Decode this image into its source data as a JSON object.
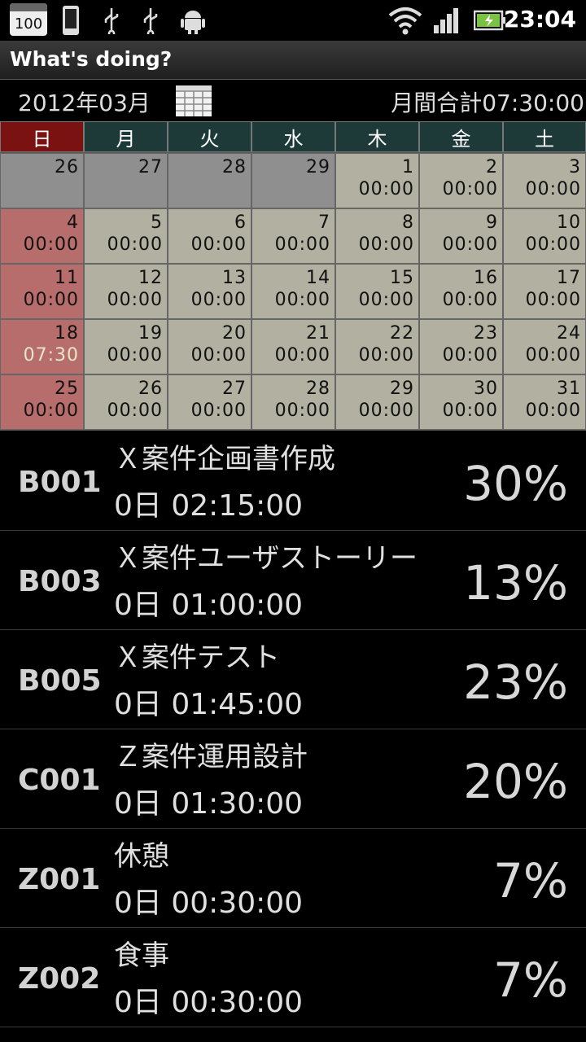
{
  "status_bar": {
    "calendar_badge": "100",
    "time": "23:04",
    "icons": [
      "calendar-icon",
      "phone-icon",
      "usb-icon",
      "usb-icon",
      "android-icon",
      "wifi-icon",
      "signal-icon",
      "battery-icon"
    ]
  },
  "app": {
    "title": "What's doing?"
  },
  "month_header": {
    "month": "2012年03月",
    "total": "月間合計07:30:00"
  },
  "calendar": {
    "weekdays": [
      "日",
      "月",
      "火",
      "水",
      "木",
      "金",
      "土"
    ],
    "weeks": [
      [
        {
          "day": "26",
          "time": "",
          "kind": "other"
        },
        {
          "day": "27",
          "time": "",
          "kind": "other"
        },
        {
          "day": "28",
          "time": "",
          "kind": "other"
        },
        {
          "day": "29",
          "time": "",
          "kind": "other"
        },
        {
          "day": "1",
          "time": "00:00",
          "kind": "normal"
        },
        {
          "day": "2",
          "time": "00:00",
          "kind": "normal"
        },
        {
          "day": "3",
          "time": "00:00",
          "kind": "normal"
        }
      ],
      [
        {
          "day": "4",
          "time": "00:00",
          "kind": "sunday"
        },
        {
          "day": "5",
          "time": "00:00",
          "kind": "normal"
        },
        {
          "day": "6",
          "time": "00:00",
          "kind": "normal"
        },
        {
          "day": "7",
          "time": "00:00",
          "kind": "normal"
        },
        {
          "day": "8",
          "time": "00:00",
          "kind": "normal"
        },
        {
          "day": "9",
          "time": "00:00",
          "kind": "normal"
        },
        {
          "day": "10",
          "time": "00:00",
          "kind": "normal"
        }
      ],
      [
        {
          "day": "11",
          "time": "00:00",
          "kind": "sunday"
        },
        {
          "day": "12",
          "time": "00:00",
          "kind": "normal"
        },
        {
          "day": "13",
          "time": "00:00",
          "kind": "normal"
        },
        {
          "day": "14",
          "time": "00:00",
          "kind": "normal"
        },
        {
          "day": "15",
          "time": "00:00",
          "kind": "normal"
        },
        {
          "day": "16",
          "time": "00:00",
          "kind": "normal"
        },
        {
          "day": "17",
          "time": "00:00",
          "kind": "normal"
        }
      ],
      [
        {
          "day": "18",
          "time": "07:30",
          "kind": "sunday",
          "highlight": true
        },
        {
          "day": "19",
          "time": "00:00",
          "kind": "normal"
        },
        {
          "day": "20",
          "time": "00:00",
          "kind": "normal"
        },
        {
          "day": "21",
          "time": "00:00",
          "kind": "normal"
        },
        {
          "day": "22",
          "time": "00:00",
          "kind": "normal"
        },
        {
          "day": "23",
          "time": "00:00",
          "kind": "normal"
        },
        {
          "day": "24",
          "time": "00:00",
          "kind": "normal"
        }
      ],
      [
        {
          "day": "25",
          "time": "00:00",
          "kind": "sunday"
        },
        {
          "day": "26",
          "time": "00:00",
          "kind": "normal"
        },
        {
          "day": "27",
          "time": "00:00",
          "kind": "normal"
        },
        {
          "day": "28",
          "time": "00:00",
          "kind": "normal"
        },
        {
          "day": "29",
          "time": "00:00",
          "kind": "normal"
        },
        {
          "day": "30",
          "time": "00:00",
          "kind": "normal"
        },
        {
          "day": "31",
          "time": "00:00",
          "kind": "normal"
        }
      ]
    ]
  },
  "tasks": [
    {
      "code": "B001",
      "name": "Ｘ案件企画書作成",
      "duration": "0日 02:15:00",
      "percent": "30%"
    },
    {
      "code": "B003",
      "name": "Ｘ案件ユーザストーリー",
      "duration": "0日 01:00:00",
      "percent": "13%"
    },
    {
      "code": "B005",
      "name": "Ｘ案件テスト",
      "duration": "0日 01:45:00",
      "percent": "23%"
    },
    {
      "code": "C001",
      "name": "Ｚ案件運用設計",
      "duration": "0日 01:30:00",
      "percent": "20%"
    },
    {
      "code": "Z001",
      "name": "休憩",
      "duration": "0日 00:30:00",
      "percent": "7%"
    },
    {
      "code": "Z002",
      "name": "食事",
      "duration": "0日 00:30:00",
      "percent": "7%"
    }
  ]
}
